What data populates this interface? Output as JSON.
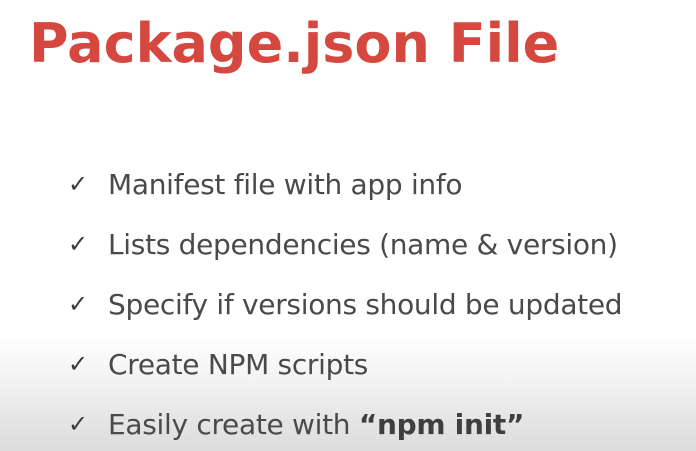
{
  "slide": {
    "title": "Package.json File",
    "bullets": [
      {
        "text": "Manifest file with app info"
      },
      {
        "text": "Lists dependencies (name & version)"
      },
      {
        "text": "Specify if versions should be updated"
      },
      {
        "text": "Create NPM scripts"
      },
      {
        "text_prefix": "Easily create with ",
        "text_strong": "“npm init”"
      }
    ],
    "bullet_icon": "check-icon",
    "colors": {
      "title": "#d4483f",
      "text": "#4a4a4a"
    }
  }
}
